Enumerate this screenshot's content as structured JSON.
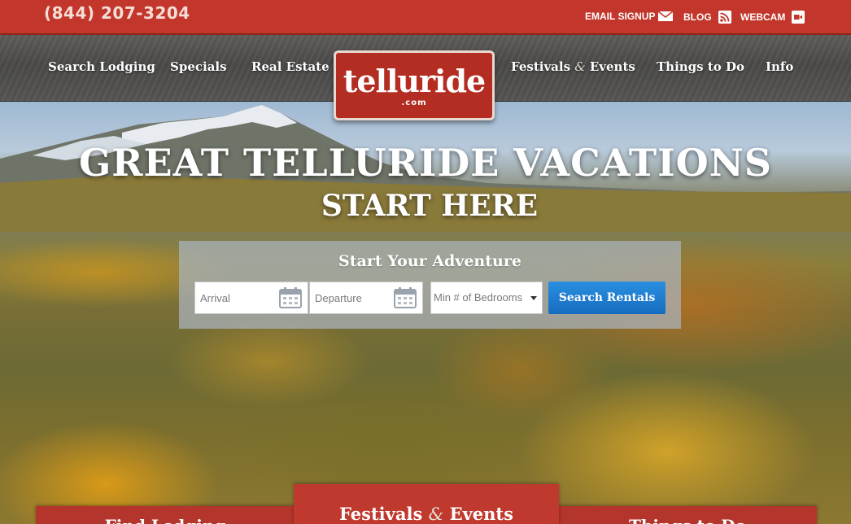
{
  "header": {
    "phone": "(844) 207-3204",
    "utility_links": [
      {
        "label": "EMAIL SIGNUP",
        "icon": "envelope-icon"
      },
      {
        "label": "BLOG",
        "icon": "rss-icon"
      },
      {
        "label": "WEBCAM",
        "icon": "video-camera-icon"
      }
    ]
  },
  "nav": {
    "left": [
      "Search Lodging",
      "Specials",
      "Real Estate"
    ],
    "festivals": {
      "part1": "Festivals",
      "amp": "&",
      "part2": "Events"
    },
    "things": "Things to Do",
    "info": "Info"
  },
  "logo": {
    "main": "telluride",
    "sub": ".com"
  },
  "hero": {
    "title": "GREAT TELLURIDE VACATIONS",
    "subtitle": "START HERE"
  },
  "search": {
    "heading": "Start Your Adventure",
    "arrival_placeholder": "Arrival",
    "departure_placeholder": "Departure",
    "bedrooms_placeholder": "Min # of Bedrooms",
    "button": "Search Rentals"
  },
  "tabs": {
    "left": "Find Lodging",
    "center": {
      "part1": "Festivals",
      "amp": "&",
      "part2": "Events"
    },
    "right": "Things to Do"
  },
  "colors": {
    "brand_red": "#c2362b",
    "button_blue": "#1f7fd4"
  }
}
